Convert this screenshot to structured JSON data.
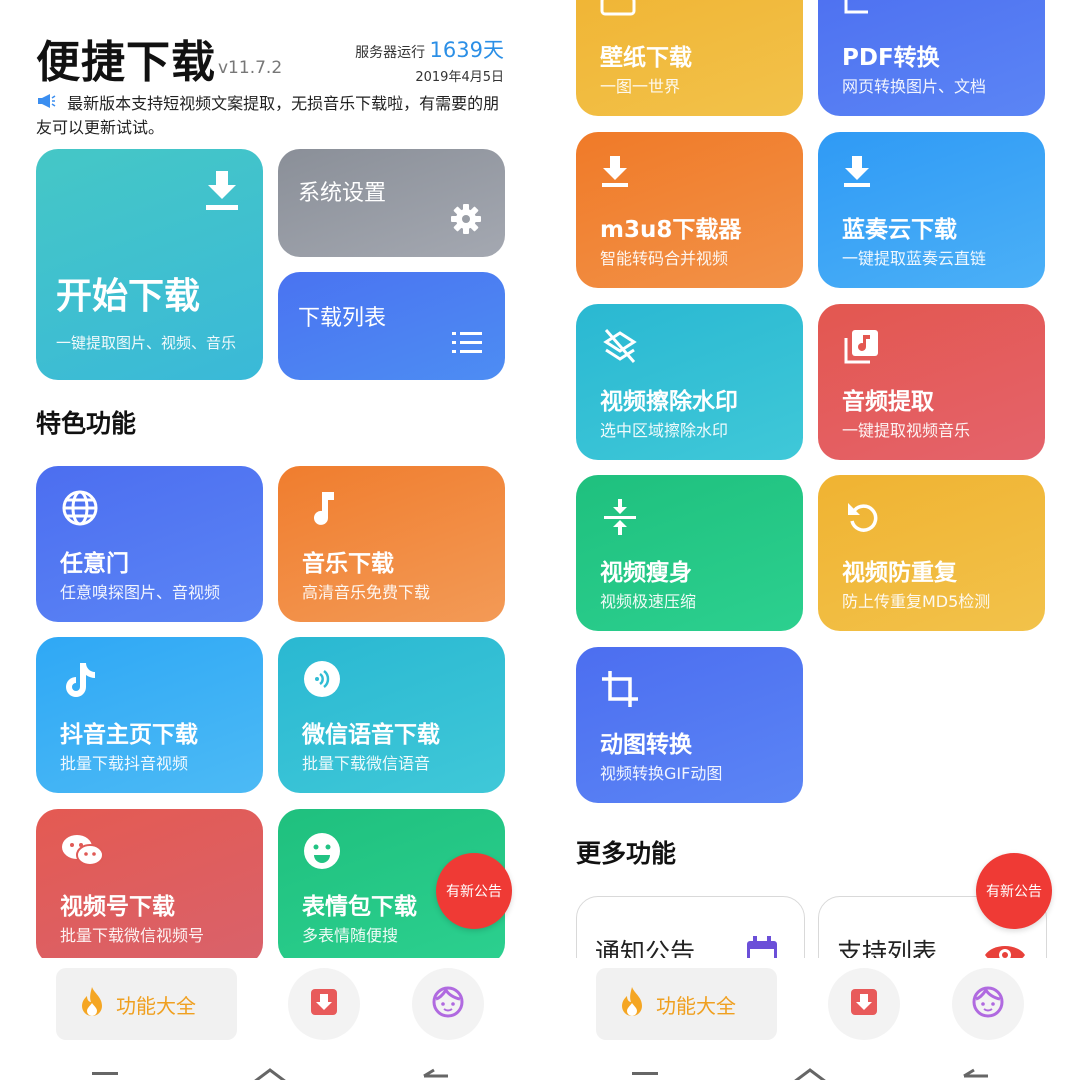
{
  "header": {
    "app_title": "便捷下载",
    "version": "v11.7.2",
    "server_label": "服务器运行",
    "server_days": "1639天",
    "date": "2019年4月5日",
    "notice": "最新版本支持短视频文案提取，无损音乐下载啦，有需要的朋友可以更新试试。"
  },
  "main_tiles": {
    "start": {
      "title": "开始下载",
      "subtitle": "一键提取图片、视频、音乐"
    },
    "settings": {
      "title": "系统设置"
    },
    "list": {
      "title": "下载列表"
    }
  },
  "sections": {
    "featured": "特色功能",
    "more": "更多功能"
  },
  "left_features": [
    {
      "title": "任意门",
      "subtitle": "任意嗅探图片、音视频",
      "icon": "globe-icon"
    },
    {
      "title": "音乐下载",
      "subtitle": "高清音乐免费下载",
      "icon": "music-note-icon"
    },
    {
      "title": "抖音主页下载",
      "subtitle": "批量下载抖音视频",
      "icon": "tiktok-icon"
    },
    {
      "title": "微信语音下载",
      "subtitle": "批量下载微信语音",
      "icon": "voice-icon"
    },
    {
      "title": "视频号下载",
      "subtitle": "批量下载微信视频号",
      "icon": "wechat-icon"
    },
    {
      "title": "表情包下载",
      "subtitle": "多表情随便搜",
      "icon": "smiley-icon"
    }
  ],
  "right_features": [
    {
      "title": "壁纸下载",
      "subtitle": "一图一世界"
    },
    {
      "title": "PDF转换",
      "subtitle": "网页转换图片、文档"
    },
    {
      "title": "m3u8下载器",
      "subtitle": "智能转码合并视频",
      "icon": "download-icon"
    },
    {
      "title": "蓝奏云下载",
      "subtitle": "一键提取蓝奏云直链",
      "icon": "download-icon"
    },
    {
      "title": "视频擦除水印",
      "subtitle": "选中区域擦除水印",
      "icon": "layers-off-icon"
    },
    {
      "title": "音频提取",
      "subtitle": "一键提取视频音乐",
      "icon": "audio-library-icon"
    },
    {
      "title": "视频瘦身",
      "subtitle": "视频极速压缩",
      "icon": "compress-icon"
    },
    {
      "title": "视频防重复",
      "subtitle": "防上传重复MD5检测",
      "icon": "rotate-icon"
    },
    {
      "title": "动图转换",
      "subtitle": "视频转换GIF动图",
      "icon": "crop-icon"
    }
  ],
  "more_cards": [
    {
      "title": "通知公告",
      "icon": "calendar-icon"
    },
    {
      "title": "支持列表",
      "icon": "eye-icon"
    }
  ],
  "badge": "有新公告",
  "bottom_nav": {
    "active_label": "功能大全"
  },
  "colors": {
    "accent_blue": "#2b8fe6",
    "badge_red": "#ef3a35",
    "active_orange": "#f0a020"
  }
}
